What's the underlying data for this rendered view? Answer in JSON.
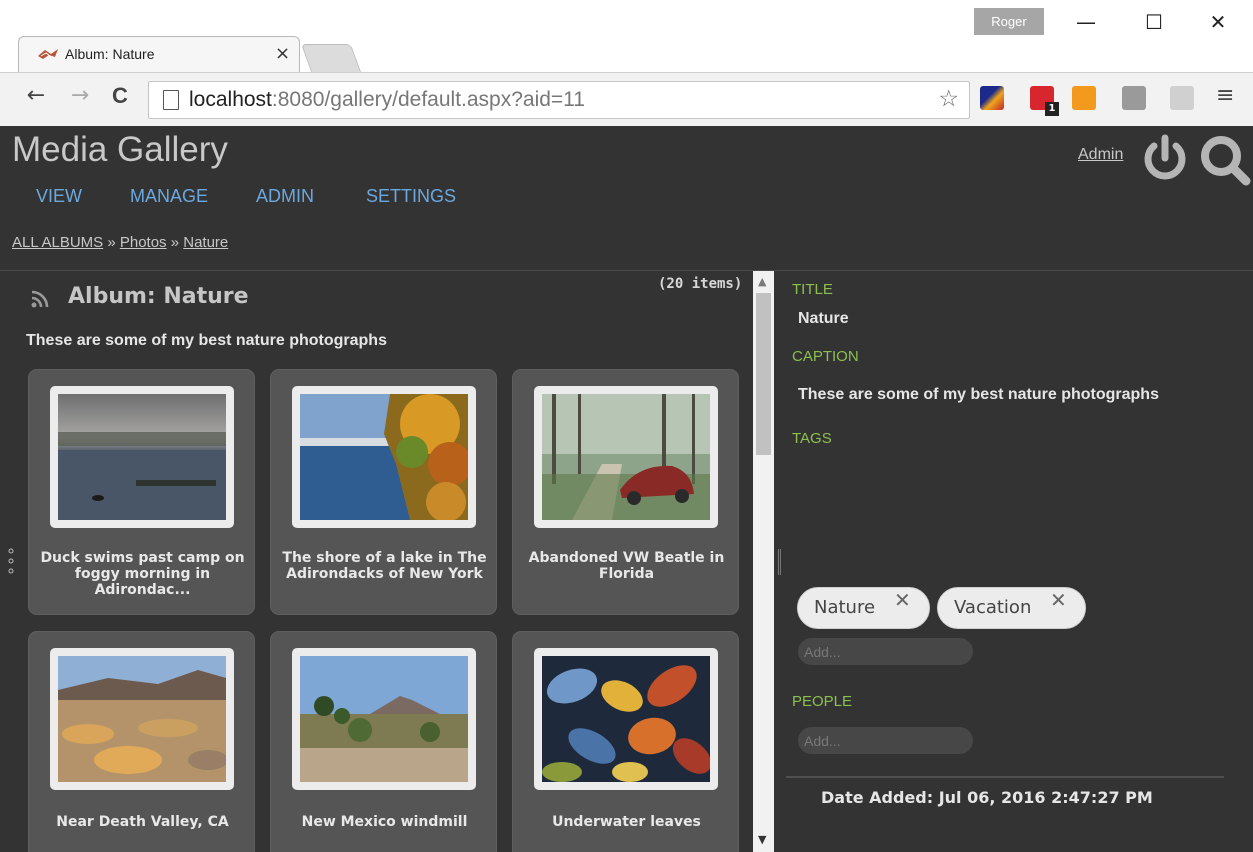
{
  "browser": {
    "profile_name": "Roger",
    "window_controls": {
      "minimize": "—",
      "maximize": "☐",
      "close": "✕"
    },
    "tab": {
      "title": "Album: Nature",
      "close": "×"
    },
    "url_host": "localhost",
    "url_path": ":8080/gallery/default.aspx?aid=11",
    "nav": {
      "back": "←",
      "forward": "→",
      "reload": "C"
    },
    "star": "☆",
    "menu": "≡",
    "extension_badge": "1"
  },
  "site": {
    "title": "Media Gallery",
    "admin_link": "Admin",
    "nav": [
      "VIEW",
      "MANAGE",
      "ADMIN",
      "SETTINGS"
    ],
    "breadcrumb": {
      "root": "ALL ALBUMS",
      "sep": "»",
      "parent": "Photos",
      "current": "Nature"
    }
  },
  "album": {
    "title": "Album: Nature",
    "count": "(20 items)",
    "caption": "These are some of my best nature photographs",
    "thumbnails": [
      {
        "caption": "Duck swims past camp on foggy morning in Adirondac..."
      },
      {
        "caption": "The shore of a lake in The Adirondacks of New York"
      },
      {
        "caption": "Abandoned VW Beatle in Florida"
      },
      {
        "caption": "Near Death Valley, CA"
      },
      {
        "caption": "New Mexico windmill"
      },
      {
        "caption": "Underwater leaves"
      }
    ]
  },
  "scrollbar": {
    "up": "▲",
    "down": "▼"
  },
  "details": {
    "title_label": "TITLE",
    "title_value": "Nature",
    "caption_label": "CAPTION",
    "caption_value": "These are some of my best nature photographs",
    "tags_label": "TAGS",
    "tags": [
      "Nature",
      "Vacation"
    ],
    "tag_remove": "✕",
    "add_placeholder": "Add...",
    "people_label": "PEOPLE",
    "date_added": "Date Added:  Jul 06, 2016 2:47:27 PM"
  },
  "colors": {
    "page_bg": "#333333",
    "nav_link": "#6ba8e0",
    "field_label": "#8cc04e",
    "card_bg": "#555555"
  }
}
